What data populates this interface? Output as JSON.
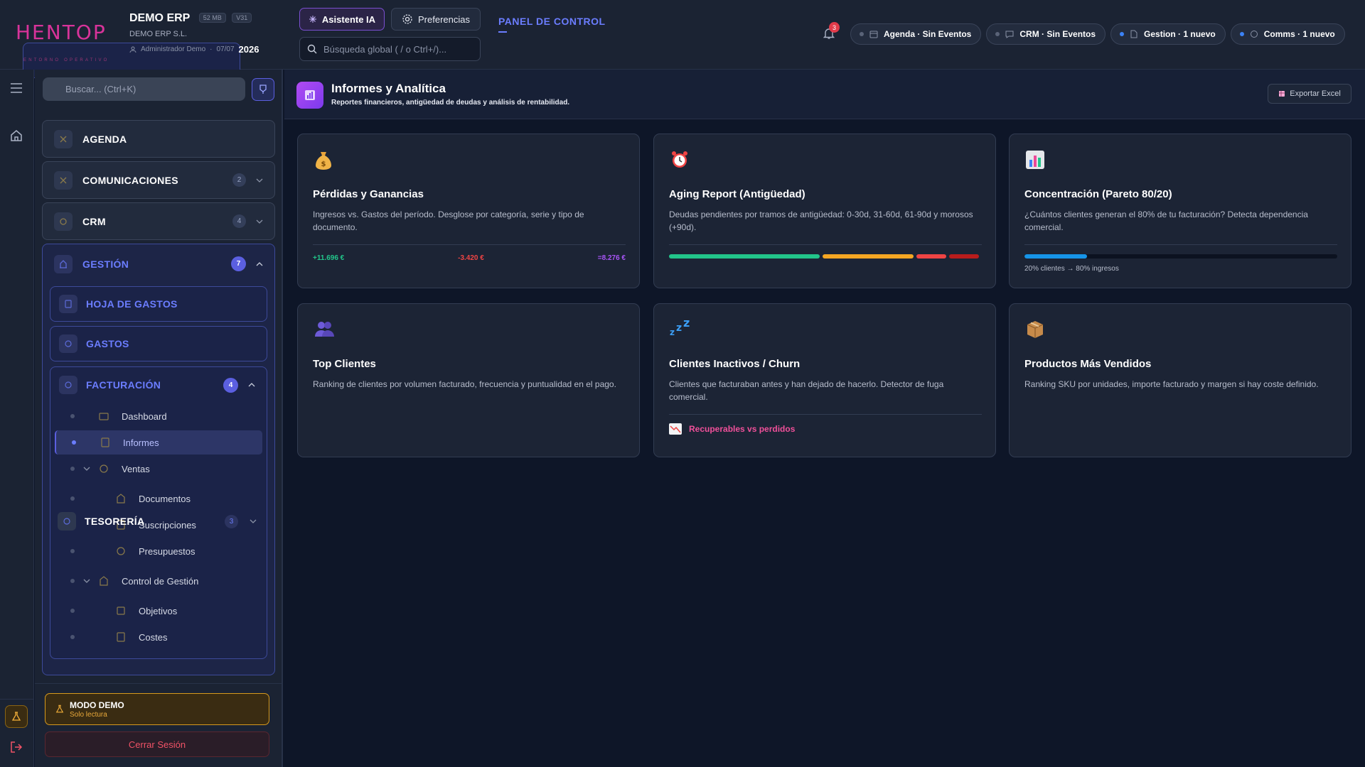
{
  "topbar": {
    "logo_text": "HENTOP",
    "logo_sub": "ENTORNO OPERATIVO",
    "company": "DEMO ERP",
    "badge_size": "52 MB",
    "badge_version": "V31",
    "legal_name": "DEMO ERP S.L.",
    "user": "Administrador Demo",
    "date": "07/07",
    "year": "2026",
    "ai_button": "Asistente IA",
    "prefs_button": "Preferencias",
    "search_placeholder": "Búsqueda global ( / o Ctrl+/)...",
    "panel_link": "PANEL DE CONTROL",
    "notif_count": "3",
    "chips": [
      {
        "label": "Agenda · Sin Eventos",
        "icon": "calendar-icon",
        "active": false
      },
      {
        "label": "CRM · Sin Eventos",
        "icon": "chat-icon",
        "active": false
      },
      {
        "label": "Gestion · 1 nuevo",
        "icon": "document-icon",
        "active": true
      },
      {
        "label": "Comms · 1 nuevo",
        "icon": "message-icon",
        "active": true
      }
    ]
  },
  "sidebar": {
    "search_placeholder": "Buscar... (Ctrl+K)",
    "sections": [
      {
        "label": "AGENDA",
        "badge": ""
      },
      {
        "label": "COMUNICACIONES",
        "badge": "2"
      },
      {
        "label": "CRM",
        "badge": "4"
      }
    ],
    "gestion": {
      "label": "GESTIÓN",
      "badge": "7",
      "subs": [
        {
          "label": "HOJA DE GASTOS"
        },
        {
          "label": "GASTOS"
        }
      ],
      "facturacion": {
        "label": "FACTURACIÓN",
        "badge": "4",
        "items": [
          {
            "label": "Dashboard"
          },
          {
            "label": "Informes"
          },
          {
            "label": "Ventas"
          },
          {
            "label": "Documentos"
          },
          {
            "label": "Suscripciones"
          },
          {
            "label": "Presupuestos"
          },
          {
            "label": "Control de Gestión"
          },
          {
            "label": "Objetivos"
          },
          {
            "label": "Costes"
          }
        ]
      }
    },
    "tesoreria": {
      "label": "TESORERÍA",
      "badge": "3"
    },
    "demo": {
      "title": "MODO DEMO",
      "subtitle": "Solo lectura"
    },
    "logout": "Cerrar Sesión"
  },
  "main": {
    "title": "Informes y Analítica",
    "subtitle": "Reportes financieros, antigüedad de deudas y análisis de rentabilidad.",
    "export": "Exportar Excel",
    "colors": {
      "green": "#22c58a",
      "red": "#ef4444",
      "purple": "#a855f7",
      "blue": "#1694e8",
      "orange": "#f5a623",
      "darkred": "#b91c1c"
    },
    "cards": [
      {
        "title": "Pérdidas y Ganancias",
        "desc": "Ingresos vs. Gastos del período. Desglose por categoría, serie y tipo de documento.",
        "icon": "money-bag-icon",
        "income": "+11.696 €",
        "expense": "-3.420 €",
        "result": "=8.276 €"
      },
      {
        "title": "Aging Report (Antigüedad)",
        "desc": "Deudas pendientes por tramos de antigüedad: 0-30d, 31-60d, 61-90d y morosos (+90d).",
        "icon": "alarm-clock-icon"
      },
      {
        "title": "Concentración (Pareto 80/20)",
        "desc": "¿Cuántos clientes generan el 80% de tu facturación? Detecta dependencia comercial.",
        "icon": "bar-chart-icon",
        "pareto_fraction": 0.2,
        "pareto_label": "20% clientes → 80% ingresos"
      },
      {
        "title": "Top Clientes",
        "desc": "Ranking de clientes por volumen facturado, frecuencia y puntualidad en el pago.",
        "icon": "users-icon"
      },
      {
        "title": "Clientes Inactivos / Churn",
        "desc": "Clientes que facturaban antes y han dejado de hacerlo. Detector de fuga comercial.",
        "icon": "sleep-icon",
        "link": "Recuperables vs perdidos"
      },
      {
        "title": "Productos Más Vendidos",
        "desc": "Ranking SKU por unidades, importe facturado y margen si hay coste definido.",
        "icon": "package-icon"
      }
    ]
  }
}
